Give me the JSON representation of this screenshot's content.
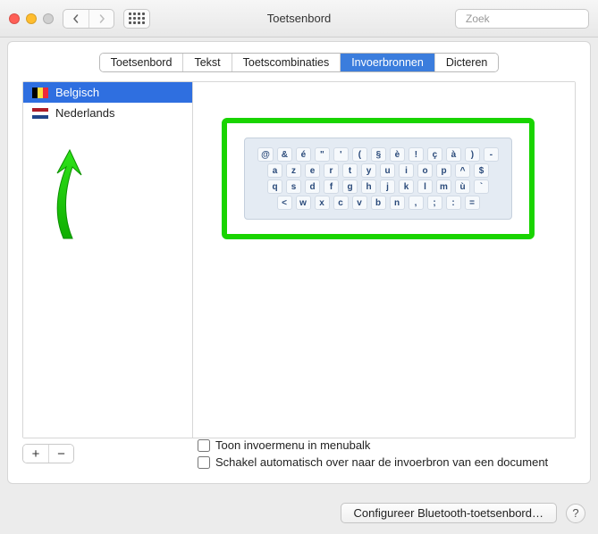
{
  "window": {
    "title": "Toetsenbord"
  },
  "search": {
    "placeholder": "Zoek"
  },
  "tabs": [
    {
      "label": "Toetsenbord",
      "active": false
    },
    {
      "label": "Tekst",
      "active": false
    },
    {
      "label": "Toetscombinaties",
      "active": false
    },
    {
      "label": "Invoerbronnen",
      "active": true
    },
    {
      "label": "Dicteren",
      "active": false
    }
  ],
  "sources": [
    {
      "label": "Belgisch",
      "flag": "be",
      "selected": true
    },
    {
      "label": "Nederlands",
      "flag": "nl",
      "selected": false
    }
  ],
  "keyboard_preview": {
    "rows": [
      [
        "@",
        "&",
        "é",
        "\"",
        "'",
        "(",
        "§",
        "è",
        "!",
        "ç",
        "à",
        ")",
        "-"
      ],
      [
        "a",
        "z",
        "e",
        "r",
        "t",
        "y",
        "u",
        "i",
        "o",
        "p",
        "^",
        "$"
      ],
      [
        "q",
        "s",
        "d",
        "f",
        "g",
        "h",
        "j",
        "k",
        "l",
        "m",
        "ù",
        "`"
      ],
      [
        "<",
        "w",
        "x",
        "c",
        "v",
        "b",
        "n",
        ",",
        ";",
        ":",
        "="
      ]
    ]
  },
  "options": {
    "show_input_menu": "Toon invoermenu in menubalk",
    "auto_switch": "Schakel automatisch over naar de invoerbron van een document"
  },
  "buttons": {
    "add": "+",
    "remove": "−",
    "configure_bt": "Configureer Bluetooth-toetsenbord…",
    "help": "?"
  },
  "annotation": {
    "highlight": "keyboard-preview-highlight",
    "arrow": "green-arrow"
  }
}
